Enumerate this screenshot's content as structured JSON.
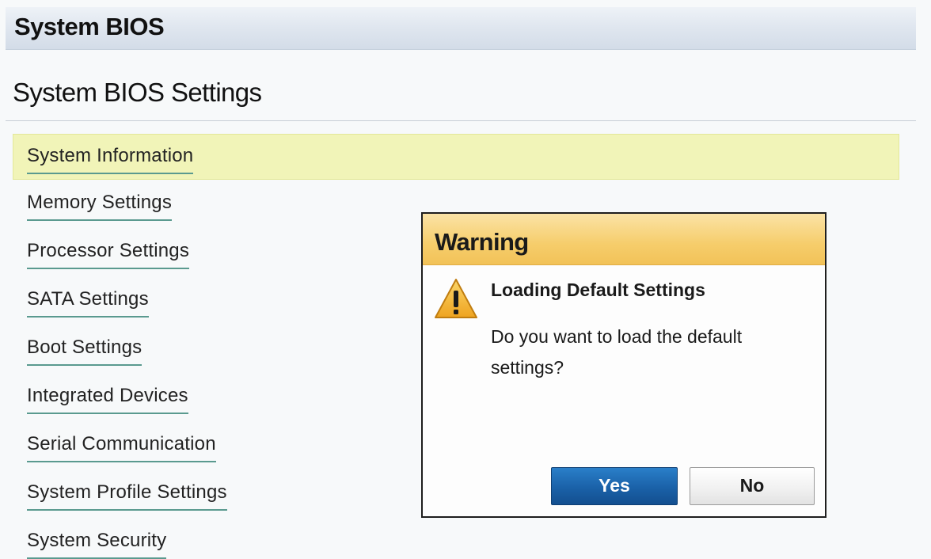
{
  "header": {
    "title": "System BIOS"
  },
  "page": {
    "title": "System BIOS Settings"
  },
  "menu": {
    "items": [
      {
        "label": "System Information"
      },
      {
        "label": "Memory Settings"
      },
      {
        "label": "Processor Settings"
      },
      {
        "label": "SATA Settings"
      },
      {
        "label": "Boot Settings"
      },
      {
        "label": "Integrated Devices"
      },
      {
        "label": "Serial Communication"
      },
      {
        "label": "System Profile Settings"
      },
      {
        "label": "System Security"
      }
    ],
    "selected_label": "System Information"
  },
  "dialog": {
    "title": "Warning",
    "icon": "warning-triangle-icon",
    "heading": "Loading Default Settings",
    "message": "Do you want to load the default settings?",
    "yes_label": "Yes",
    "no_label": "No"
  },
  "colors": {
    "header_bar": "#dfe6ef",
    "selected_item": "#f1f4b8",
    "menu_underline": "#5a9a8f",
    "dialog_header": "#f6cd6b",
    "yes_button": "#1a61a8",
    "warning_icon": "#f2b632"
  }
}
